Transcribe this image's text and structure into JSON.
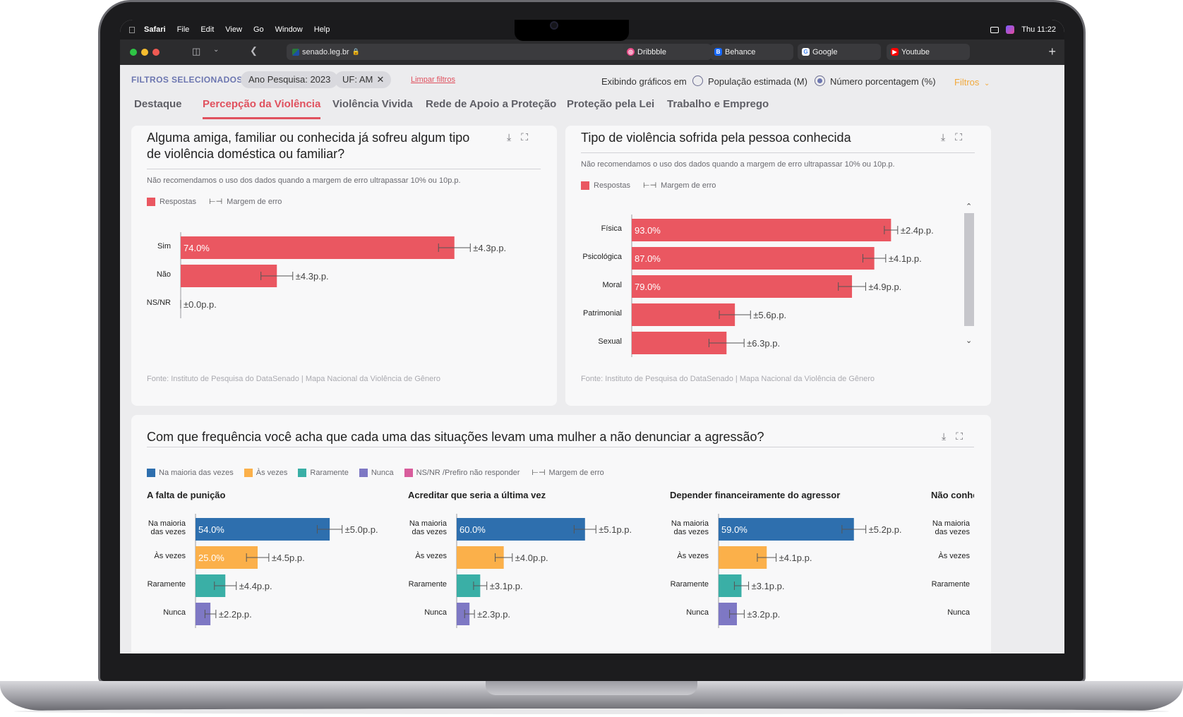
{
  "menubar": {
    "app": "Safari",
    "items": [
      "File",
      "Edit",
      "View",
      "Go",
      "Window",
      "Help"
    ],
    "clock": "Thu 11:22"
  },
  "browser": {
    "url": "senado.leg.br",
    "tabs": [
      {
        "label": "Dribbble",
        "icon": "dribbble-icon",
        "color": "#ea4c89"
      },
      {
        "label": "Behance",
        "icon": "behance-icon",
        "color": "#1769ff"
      },
      {
        "label": "Google",
        "icon": "google-icon",
        "color": "#4285f4"
      },
      {
        "label": "Youtube",
        "icon": "youtube-icon",
        "color": "#ff0000"
      }
    ]
  },
  "filters": {
    "label": "FILTROS SELECIONADOS:",
    "chips": [
      "Ano Pesquisa: 2023",
      "UF: AM"
    ],
    "clear": "Limpar filtros",
    "display_label": "Exibindo gráficos em",
    "option_a": "População estimada (M)",
    "option_b": "Número porcentagem (%)",
    "selected": "option_b",
    "filtros_button": "Filtros"
  },
  "page_tabs": [
    "Destaque",
    "Percepção da Violência",
    "Violência Vivida",
    "Rede de Apoio a Proteção",
    "Proteção pela Lei",
    "Trabalho e Emprego"
  ],
  "active_tab": "Percepção da Violência",
  "colors": {
    "accent": "#e0515e",
    "bar_red": "#ea5761",
    "blue": "#2e6fae",
    "orange": "#fbb04a",
    "teal": "#3aafa6",
    "purple": "#7e78c4",
    "pink": "#d85c9c"
  },
  "cards": {
    "card1": {
      "title_line1": "Alguma amiga, familiar ou conhecida já sofreu algum tipo",
      "title_line2": "de violência doméstica ou familiar?",
      "note": "Não recomendamos o uso dos dados quando a margem de erro ultrapassar 10% ou 10p.p.",
      "legend_respostas": "Respostas",
      "legend_margem": "Margem de erro",
      "source": "Fonte: Instituto de Pesquisa do DataSenado | Mapa Nacional da Violência de Gênero"
    },
    "card2": {
      "title": "Tipo de violência sofrida pela pessoa conhecida",
      "note": "Não recomendamos o uso dos dados quando a margem de erro ultrapassar 10% ou 10p.p.",
      "legend_respostas": "Respostas",
      "legend_margem": "Margem de erro",
      "source": "Fonte: Instituto de Pesquisa do DataSenado | Mapa Nacional da Violência de Gênero"
    },
    "card3": {
      "title": "Com que frequência você acha que cada uma das situações levam uma mulher a não denunciar a agressão?",
      "legend": [
        "Na maioria das vezes",
        "Às vezes",
        "Raramente",
        "Nunca",
        "NS/NR /Prefiro não responder",
        "Margem de erro"
      ]
    }
  },
  "chart_data": [
    {
      "type": "bar",
      "orientation": "horizontal",
      "categories": [
        "Sim",
        "Não",
        "NS/NR"
      ],
      "values": [
        74.0,
        26.0,
        0.0
      ],
      "value_labels": [
        "74.0%",
        "",
        ""
      ],
      "errors": [
        "±4.3p.p.",
        "±4.3p.p.",
        "±0.0p.p."
      ],
      "series": [
        {
          "name": "Respostas",
          "values": [
            74.0,
            26.0,
            0.0
          ]
        }
      ],
      "xlim": [
        0,
        100
      ]
    },
    {
      "type": "bar",
      "orientation": "horizontal",
      "categories": [
        "Física",
        "Psicológica",
        "Moral",
        "Patrimonial",
        "Sexual"
      ],
      "values": [
        93.0,
        87.0,
        79.0,
        37.0,
        34.0
      ],
      "value_labels": [
        "93.0%",
        "87.0%",
        "79.0%",
        "",
        ""
      ],
      "errors": [
        "±2.4p.p.",
        "±4.1p.p.",
        "±4.9p.p.",
        "±5.6p.p.",
        "±6.3p.p."
      ],
      "series": [
        {
          "name": "Respostas",
          "values": [
            93.0,
            87.0,
            79.0,
            37.0,
            34.0
          ]
        }
      ],
      "xlim": [
        0,
        100
      ]
    },
    {
      "type": "bar",
      "orientation": "horizontal",
      "title": "A falta de punição",
      "categories": [
        "Na maioria das vezes",
        "Às vezes",
        "Raramente",
        "Nunca"
      ],
      "values": [
        54.0,
        25.0,
        12.0,
        6.0
      ],
      "value_labels": [
        "54.0%",
        "25.0%",
        "",
        ""
      ],
      "errors": [
        "±5.0p.p.",
        "±4.5p.p.",
        "±4.4p.p.",
        "±2.2p.p."
      ],
      "xlim": [
        0,
        100
      ]
    },
    {
      "type": "bar",
      "orientation": "horizontal",
      "title": "Acreditar que seria a última vez",
      "categories": [
        "Na maioria das vezes",
        "Às vezes",
        "Raramente",
        "Nunca"
      ],
      "values": [
        60.0,
        22.0,
        11.0,
        6.0
      ],
      "value_labels": [
        "60.0%",
        "",
        "",
        ""
      ],
      "errors": [
        "±5.1p.p.",
        "±4.0p.p.",
        "±3.1p.p.",
        "±2.3p.p."
      ],
      "xlim": [
        0,
        100
      ]
    },
    {
      "type": "bar",
      "orientation": "horizontal",
      "title": "Depender financeiramente do agressor",
      "categories": [
        "Na maioria das vezes",
        "Às vezes",
        "Raramente",
        "Nunca"
      ],
      "values": [
        59.0,
        21.0,
        10.0,
        8.0
      ],
      "value_labels": [
        "59.0%",
        "",
        "",
        ""
      ],
      "errors": [
        "±5.2p.p.",
        "±4.1p.p.",
        "±3.1p.p.",
        "±3.2p.p."
      ],
      "xlim": [
        0,
        100
      ]
    },
    {
      "type": "bar",
      "orientation": "horizontal",
      "title": "Não conhe",
      "categories": [
        "Na maioria das vezes",
        "Às vezes",
        "Raramente",
        "Nunca"
      ],
      "values": [],
      "xlim": [
        0,
        100
      ]
    }
  ]
}
